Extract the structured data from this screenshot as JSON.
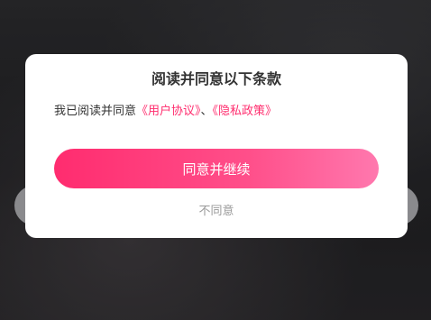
{
  "dialog": {
    "title": "阅读并同意以下条款",
    "message_prefix": "我已阅读并同意",
    "user_agreement_link": "《用户协议》",
    "separator": "、",
    "privacy_policy_link": "《隐私政策》",
    "agree_label": "同意并继续",
    "disagree_label": "不同意"
  },
  "colors": {
    "accent": "#ff2d6e",
    "button_gradient_start": "#ff2c6f",
    "button_gradient_end": "#ff78ae",
    "secondary_text": "#999999"
  }
}
